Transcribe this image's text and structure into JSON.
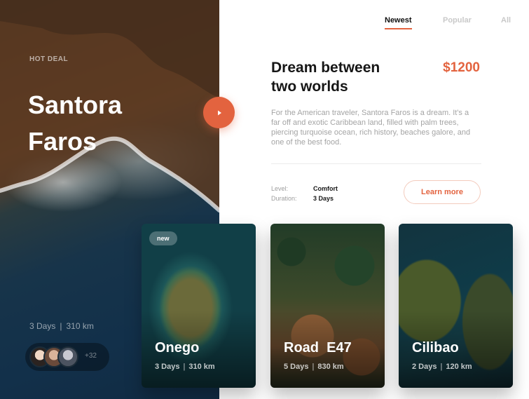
{
  "hero": {
    "label": "HOT DEAL",
    "title_line1": "Santora",
    "title_line2": "Faros",
    "days": "3 Days",
    "distance": "310 km",
    "travelers_extra": "+32"
  },
  "tabs": [
    {
      "label": "Newest",
      "active": true
    },
    {
      "label": "Popular",
      "active": false
    },
    {
      "label": "All",
      "active": false
    }
  ],
  "deal": {
    "title_line1": "Dream between",
    "title_line2": "two worlds",
    "price": "$1200",
    "description": "For the American traveler, Santora Faros is a dream. It's a far off and exotic Caribbean land, filled with palm trees, piercing turquoise ocean, rich history, beaches galore, and  one of the best food.",
    "level_label": "Level:",
    "level_value": "Comfort",
    "duration_label": "Duration:",
    "duration_value": "3 Days",
    "cta": "Learn more"
  },
  "cards": [
    {
      "name": "Onego",
      "days": "3 Days",
      "distance": "310 km",
      "badge": "new"
    },
    {
      "name": "Road  E47",
      "days": "5 Days",
      "distance": "830 km"
    },
    {
      "name": "Cilibao",
      "days": "2 Days",
      "distance": "120 km"
    }
  ],
  "colors": {
    "accent": "#e3633f",
    "text_dark": "#161616",
    "text_muted": "#a4a4a4"
  },
  "icons": {
    "play": "play-icon"
  }
}
